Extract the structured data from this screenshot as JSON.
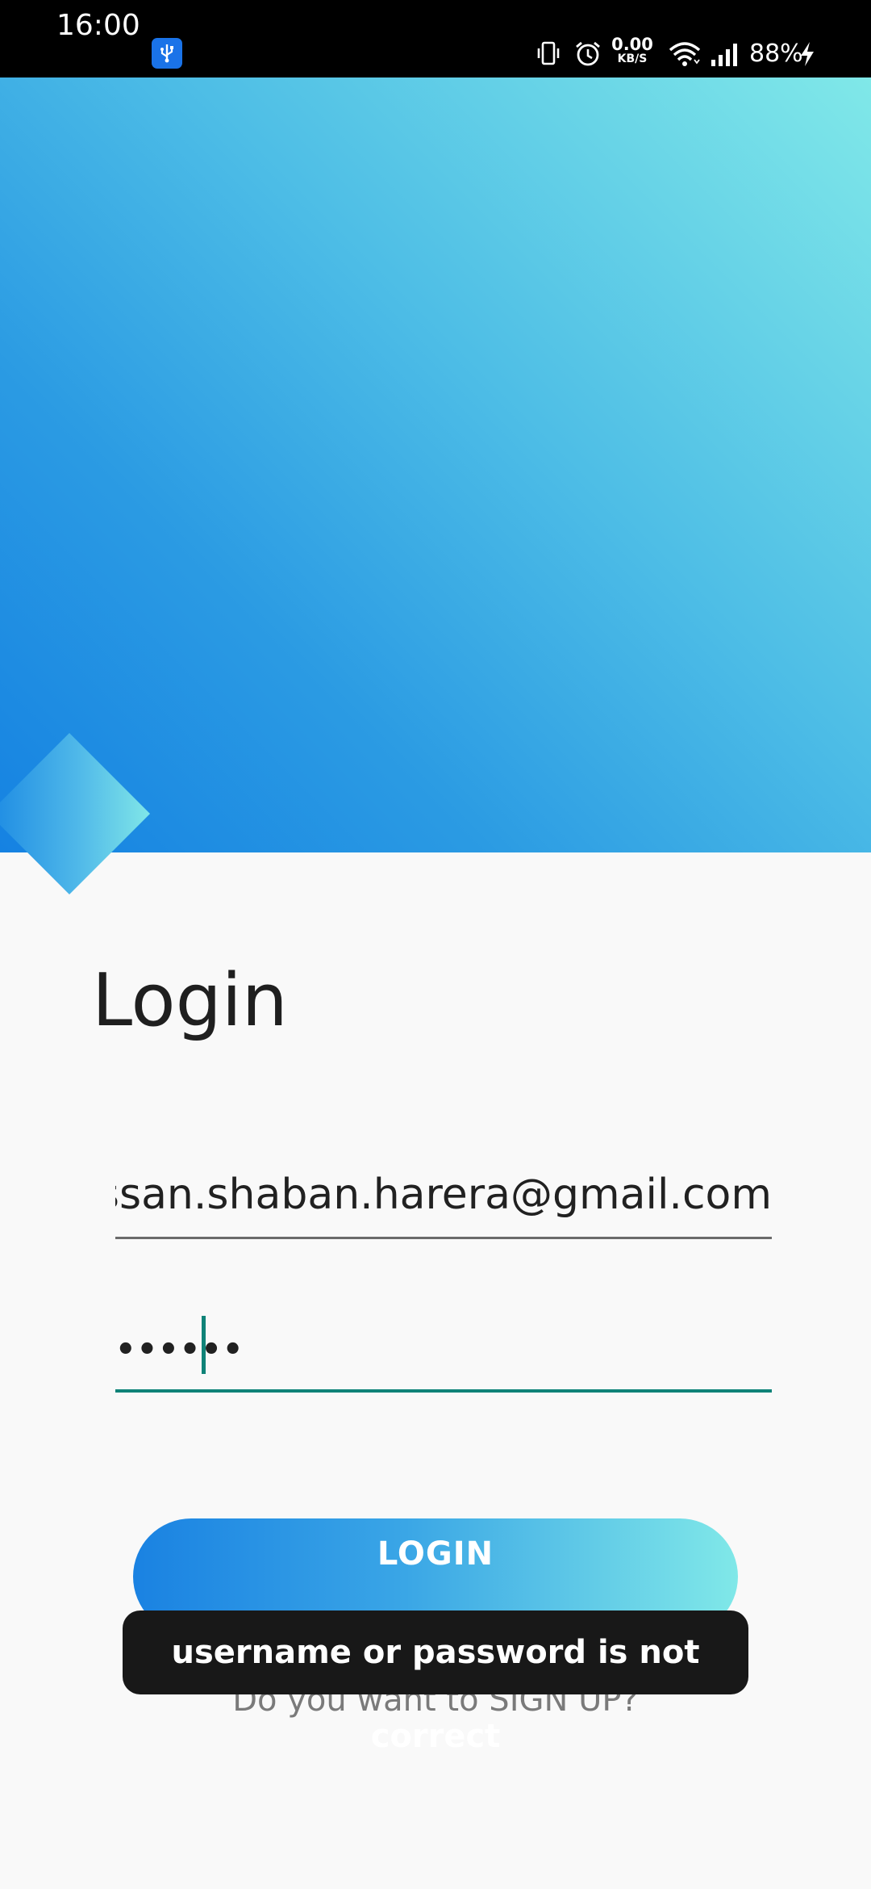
{
  "status_bar": {
    "time": "16:00",
    "net_speed_value": "0.00",
    "net_speed_unit": "KB/S",
    "battery": "88%",
    "icons": [
      "usb-debugging-icon",
      "vibrate-icon",
      "alarm-icon",
      "wifi-icon",
      "cellular-signal-icon",
      "charging-icon"
    ]
  },
  "login": {
    "title": "Login",
    "email_value": "hassan.shaban.harera@gmail.com",
    "password_mask": "••••••",
    "button_label": "LOGIN",
    "signup_prompt": "Do you want to SIGN UP?"
  },
  "toast": {
    "message": "username or password is not correct"
  },
  "colors": {
    "accent": "#0f8378",
    "gradient_start": "#1582e2",
    "gradient_end": "#80e8e8",
    "toast_bg": "#181818"
  }
}
